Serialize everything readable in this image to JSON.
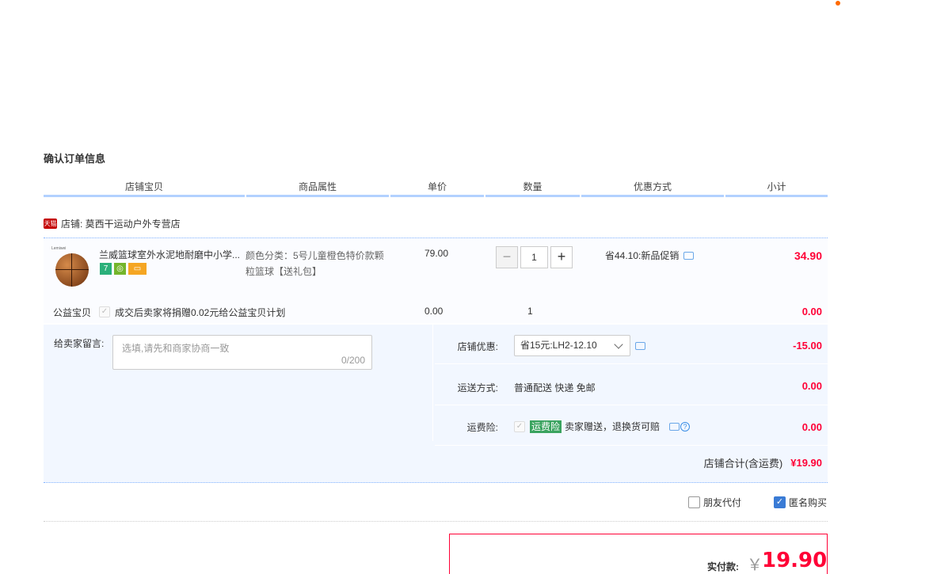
{
  "section_title": "确认订单信息",
  "table_headers": [
    "店铺宝贝",
    "商品属性",
    "单价",
    "数量",
    "优惠方式",
    "小计"
  ],
  "shop": {
    "badge": "天猫",
    "label": "店铺: 莫西干运动户外专营店"
  },
  "item": {
    "brand_on_image": "Lemiwei",
    "name": "兰威篮球室外水泥地耐磨中小学...",
    "attr": "颜色分类：5号儿童橙色特价款颗粒篮球【送礼包】",
    "price": "79.00",
    "quantity": "1",
    "promo": "省44.10:新品促销",
    "subtotal": "34.90",
    "icons": [
      "7",
      "shield",
      "card"
    ]
  },
  "charity": {
    "label": "公益宝贝",
    "check": "✓",
    "text": "成交后卖家将捐赠0.02元给公益宝贝计划",
    "price": "0.00",
    "quantity": "1",
    "subtotal": "0.00"
  },
  "message": {
    "label": "给卖家留言:",
    "placeholder": "选填,请先和商家协商一致",
    "count": "0/200"
  },
  "shop_discount": {
    "label": "店铺优惠:",
    "selected": "省15元:LH2-12.10",
    "amount": "-15.00"
  },
  "shipping": {
    "label": "运送方式:",
    "value": "普通配送 快递 免邮",
    "amount": "0.00"
  },
  "insurance": {
    "label": "运费险:",
    "check": "✓",
    "badge": "运费险",
    "text": "卖家赠送，退换货可赔",
    "amount": "0.00",
    "help": "?"
  },
  "shop_total": {
    "label": "店铺合计(含运费)",
    "amount": "¥19.90"
  },
  "options": {
    "friend_pay": "朋友代付",
    "anonymous": "匿名购买",
    "anonymous_check": "✓"
  },
  "payment": {
    "label": "实付款:",
    "yen": "￥",
    "amount": "19.90"
  },
  "colors": {
    "accent": "#ff0036",
    "header_line": "#b2d1ff",
    "panel_bg": "#f2f7ff"
  }
}
